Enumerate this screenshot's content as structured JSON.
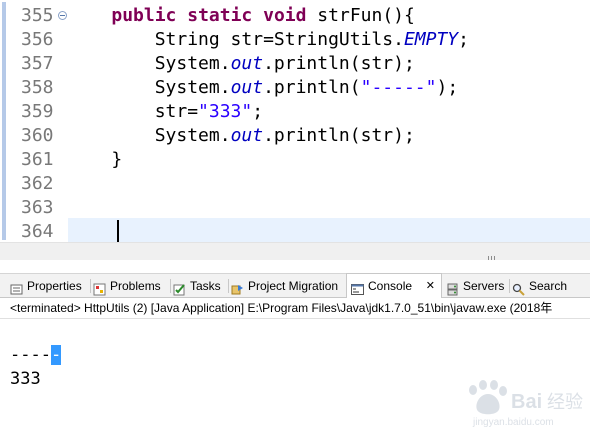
{
  "editor": {
    "lines": [
      {
        "num": "355",
        "fold": true,
        "tokens": [
          {
            "t": "    "
          },
          {
            "t": "public",
            "c": "kw"
          },
          {
            "t": " "
          },
          {
            "t": "static",
            "c": "kw"
          },
          {
            "t": " "
          },
          {
            "t": "void",
            "c": "kw"
          },
          {
            "t": " strFun(){"
          }
        ]
      },
      {
        "num": "356",
        "tokens": [
          {
            "t": "        String str=StringUtils."
          },
          {
            "t": "EMPTY",
            "c": "fld"
          },
          {
            "t": ";"
          }
        ]
      },
      {
        "num": "357",
        "tokens": [
          {
            "t": "        System."
          },
          {
            "t": "out",
            "c": "fld"
          },
          {
            "t": ".println(str);"
          }
        ]
      },
      {
        "num": "358",
        "tokens": [
          {
            "t": "        System."
          },
          {
            "t": "out",
            "c": "fld"
          },
          {
            "t": ".println("
          },
          {
            "t": "\"-----\"",
            "c": "str"
          },
          {
            "t": ");"
          }
        ]
      },
      {
        "num": "359",
        "tokens": [
          {
            "t": "        str="
          },
          {
            "t": "\"333\"",
            "c": "str"
          },
          {
            "t": ";"
          }
        ]
      },
      {
        "num": "360",
        "tokens": [
          {
            "t": "        System."
          },
          {
            "t": "out",
            "c": "fld"
          },
          {
            "t": ".println(str);"
          }
        ]
      },
      {
        "num": "361",
        "tokens": [
          {
            "t": "    }"
          }
        ]
      },
      {
        "num": "362",
        "tokens": []
      },
      {
        "num": "363",
        "tokens": []
      },
      {
        "num": "364",
        "tokens": [],
        "current": true
      }
    ]
  },
  "tabs": [
    {
      "label": "Properties",
      "icon": "properties-icon"
    },
    {
      "label": "Problems",
      "icon": "problems-icon"
    },
    {
      "label": "Tasks",
      "icon": "tasks-icon"
    },
    {
      "label": "Project Migration",
      "icon": "project-migration-icon"
    },
    {
      "label": "Console",
      "icon": "console-icon",
      "active": true,
      "close": "✕"
    },
    {
      "label": "Servers",
      "icon": "servers-icon"
    },
    {
      "label": "Search",
      "icon": "search-icon"
    }
  ],
  "console": {
    "description": "<terminated> HttpUtils (2) [Java Application] E:\\Program Files\\Java\\jdk1.7.0_51\\bin\\javaw.exe (2018年",
    "output": {
      "line1_plain": "----",
      "line1_selected": "-",
      "line2": "333"
    }
  },
  "watermark": {
    "text": "Bai 经验",
    "subtext": "jingyan.baidu.com"
  },
  "colors": {
    "keyword": "#7f0055",
    "static_field": "#0000c0",
    "string": "#2a00ff",
    "current_line": "#e8f2fe",
    "selection": "#3399ff"
  }
}
